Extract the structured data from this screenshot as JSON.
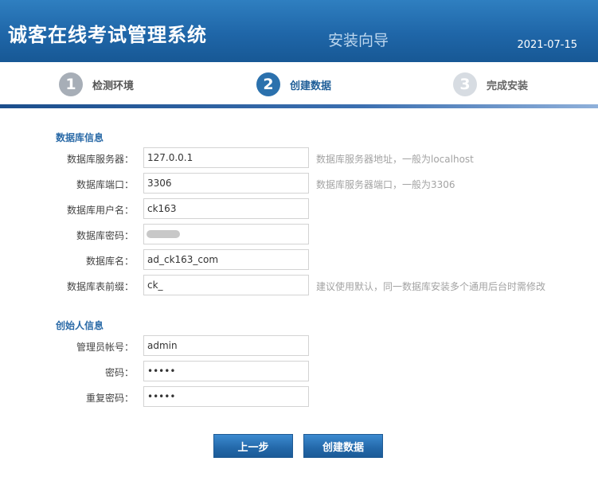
{
  "header": {
    "brand": "诚客在线考试管理系统",
    "wizard_title": "安装向导",
    "date": "2021-07-15"
  },
  "steps": [
    {
      "num": "1",
      "label": "检测环境",
      "state": "done"
    },
    {
      "num": "2",
      "label": "创建数据",
      "state": "active"
    },
    {
      "num": "3",
      "label": "完成安装",
      "state": "todo"
    }
  ],
  "db_section": {
    "title": "数据库信息",
    "server": {
      "label": "数据库服务器：",
      "value": "127.0.0.1",
      "tip": "数据库服务器地址，一般为localhost"
    },
    "port": {
      "label": "数据库端口：",
      "value": "3306",
      "tip": "数据库服务器端口，一般为3306"
    },
    "user": {
      "label": "数据库用户名：",
      "value": "ck163"
    },
    "password": {
      "label": "数据库密码："
    },
    "name": {
      "label": "数据库名：",
      "value": "ad_ck163_com"
    },
    "prefix": {
      "label": "数据库表前缀：",
      "value": "ck_",
      "tip": "建议使用默认，同一数据库安装多个通用后台时需修改"
    }
  },
  "founder_section": {
    "title": "创始人信息",
    "account": {
      "label": "管理员帐号：",
      "value": "admin"
    },
    "password": {
      "label": "密码：",
      "value": "•••••"
    },
    "repeat": {
      "label": "重复密码：",
      "value": "•••••"
    }
  },
  "buttons": {
    "prev": "上一步",
    "create": "创建数据"
  }
}
